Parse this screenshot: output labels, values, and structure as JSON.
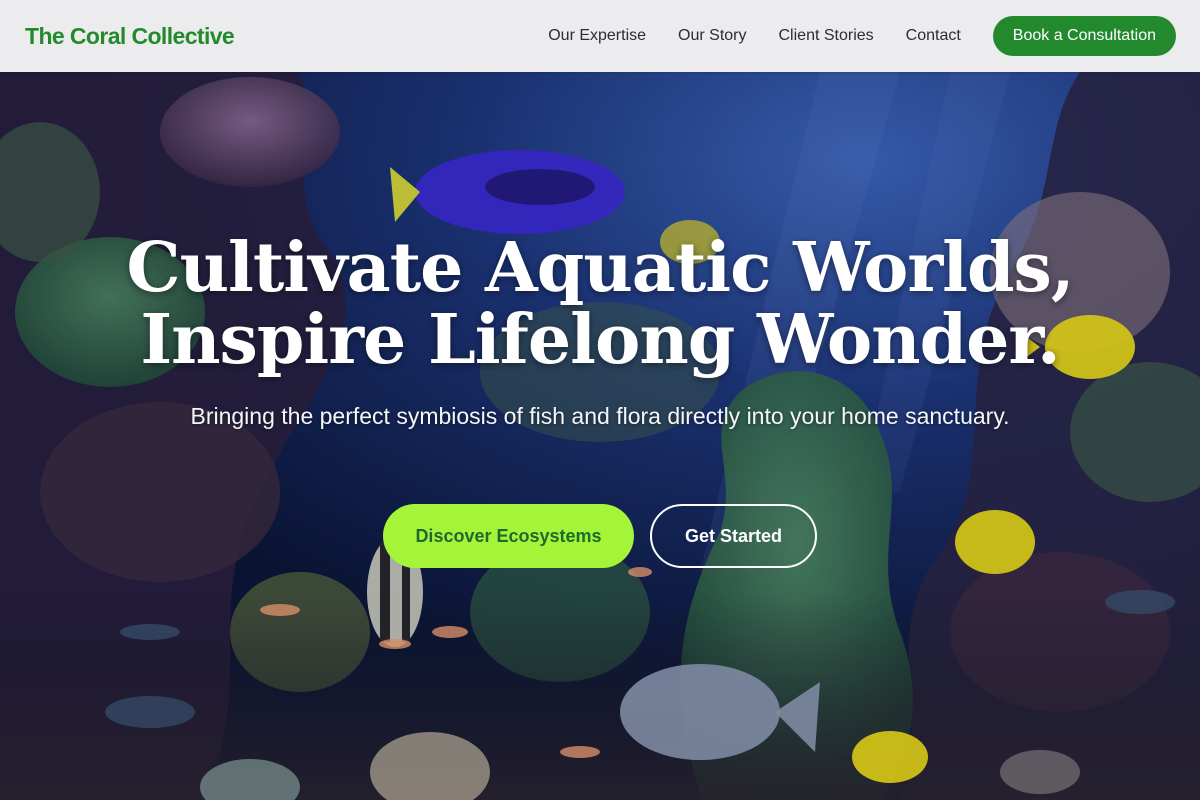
{
  "header": {
    "logo": "The Coral Collective",
    "nav": [
      "Our Expertise",
      "Our Story",
      "Client Stories",
      "Contact"
    ],
    "cta_label": "Book a Consultation"
  },
  "hero": {
    "headline_line1": "Cultivate Aquatic Worlds,",
    "headline_line2": "Inspire Lifelong Wonder.",
    "subheadline": "Bringing the perfect symbiosis of fish and flora directly into your home sanctuary.",
    "primary_button": "Discover Ecosystems",
    "secondary_button": "Get Started"
  },
  "colors": {
    "brand_green": "#238a2b",
    "cta_green": "#23892d",
    "lime_accent": "#a4f53a"
  }
}
